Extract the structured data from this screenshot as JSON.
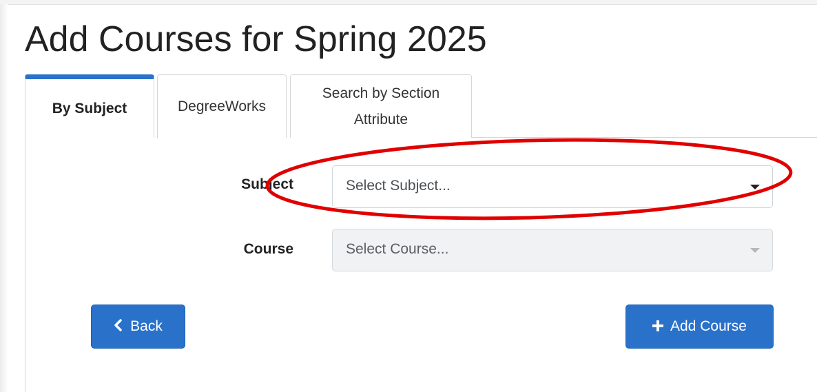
{
  "page": {
    "title": "Add Courses for Spring 2025"
  },
  "tabs": [
    {
      "label": "By Subject",
      "active": true
    },
    {
      "label": "DegreeWorks",
      "active": false
    },
    {
      "label": "Search by Section Attribute",
      "active": false
    }
  ],
  "form": {
    "subject": {
      "label": "Subject",
      "placeholder": "Select Subject..."
    },
    "course": {
      "label": "Course",
      "placeholder": "Select Course...",
      "disabled": true
    }
  },
  "buttons": {
    "back_label": "Back",
    "back_icon": "chevron-left-icon",
    "add_label": "Add Course",
    "add_icon": "plus-icon"
  },
  "annotation": {
    "shape": "ellipse",
    "color": "#e00000",
    "target": "subject-select"
  },
  "colors": {
    "accent": "#2a71c9",
    "annotation": "#e00000"
  }
}
